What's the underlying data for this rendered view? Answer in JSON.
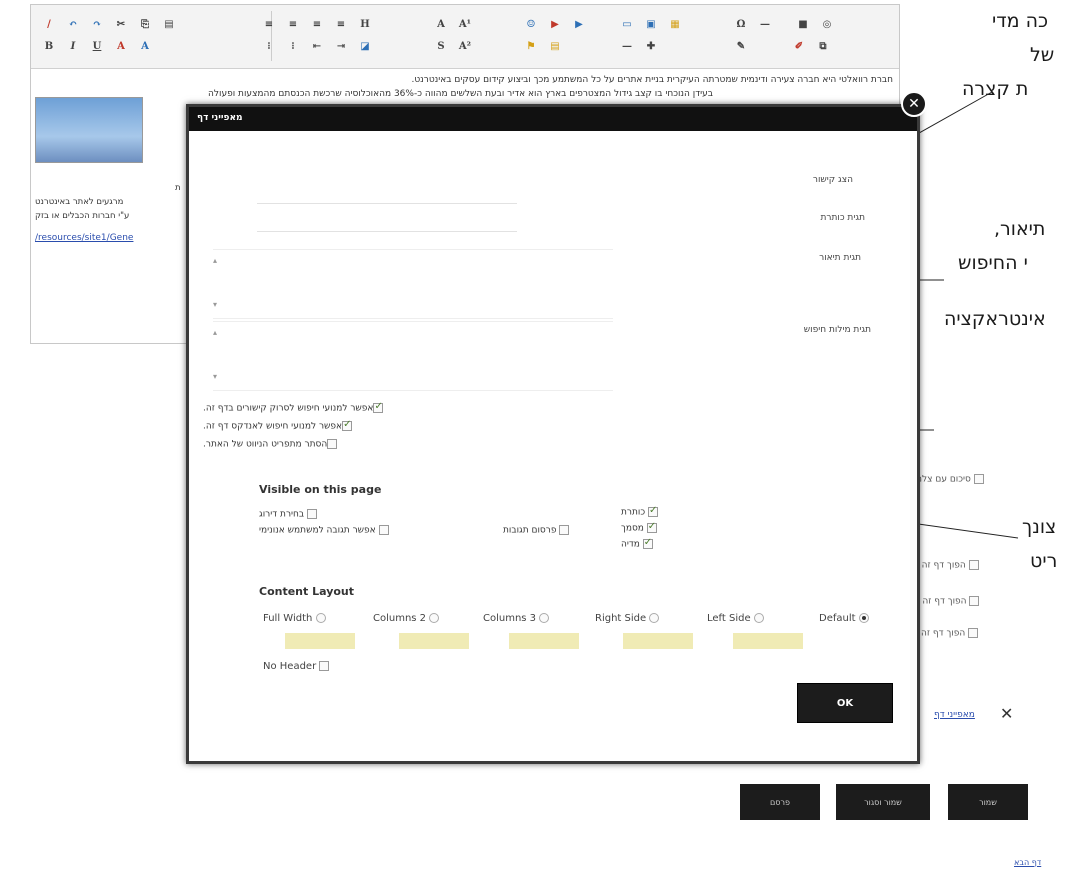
{
  "editor": {
    "toolbar": {
      "row1": [
        "/",
        "↶",
        "↷",
        "✂",
        "⎘",
        "📋",
        "≡",
        "≡",
        "≡",
        "≡",
        "H",
        "A",
        "A¹",
        "☺",
        "▶",
        "▶",
        "▭",
        "▣",
        "▦",
        "Ω",
        "—",
        "■",
        "◎"
      ],
      "row2": [
        "B",
        "I",
        "U",
        "A",
        "A",
        "⁝≡",
        "⁝≡",
        "⇤",
        "⇥",
        "◪",
        "S",
        "A²",
        "⚑",
        "▤",
        "—",
        "✚",
        "✎",
        "✐",
        "⧉"
      ]
    },
    "text_line1": "חברת רוואלטי היא חברה צעירה ודינמית שמטרתה העיקרית בניית אתרים על כל המשתמע מכך וביצוע קידום עסקים באינטרנט.",
    "text_line2": "בעידן הנוכחי בו קצב גידול המצטרפים בארץ הוא אדיר ובעת השלשים מהווה כ-36% מהאוכלוסיה שרכשת הכנסתם מהמצעות ופעולה",
    "left_snippet1": "ת",
    "left_snippet2": "מרגעים לאתר באינטרנט",
    "left_snippet3": "ע\"י חברות הכבלים או בזק",
    "link": "/resources/site1/Gene"
  },
  "annotations": {
    "a1_line1": "כה מדי",
    "a1_line2": "של",
    "a1_line3": "ת קצרה",
    "a2_line1": "תיאור,",
    "a2_line2": "י החיפוש",
    "a3": "אינטראקציה",
    "a4_line1": "צונך",
    "a4_line2": "ריט"
  },
  "right_panel": {
    "cb1": "סיכום עם צלמית",
    "cb2": "הפוך דף זה לפ",
    "cb3": "הפוך דף זה לק",
    "cb4": "הפוך דף זה לר",
    "page_editor": "מאפייני דף"
  },
  "dialog": {
    "title": "מאפייני דף",
    "close": "✕",
    "labels": {
      "link": "הצג קישור",
      "title_tag": "תגית כותרת",
      "desc_tag": "תגית תיאור",
      "keywords_tag": "תגית מילות חיפוש"
    },
    "checkboxes": {
      "allow_scan": "אפשר למנועי חיפוש לסרוק קישורים בדף זה.",
      "allow_index": "אפשר למנועי חיפוש לאנדקס דף זה.",
      "hide_sitemap": "הסתר מתפריט הניווט של האתר."
    },
    "visible_title": "Visible on this page",
    "visible": {
      "title": "כותרת",
      "sub": "מסמך",
      "media": "מדיה",
      "date": "בחירת דירוג",
      "tags": "פרסום תגובות",
      "anon": "אפשר תגובה למשתמש אנונימי"
    },
    "layout_title": "Content Layout",
    "layout": {
      "full": "Full Width",
      "col2": "Columns 2",
      "col3": "Columns 3",
      "right": "Right Side",
      "left": "Left Side",
      "default": "Default"
    },
    "no_header": "No Header",
    "ok": "OK"
  },
  "bottom": {
    "btn_save": "שמור",
    "btn_save_close": "שמור וסגור",
    "btn_publish": "פרסם",
    "footer": "דף הבא"
  }
}
